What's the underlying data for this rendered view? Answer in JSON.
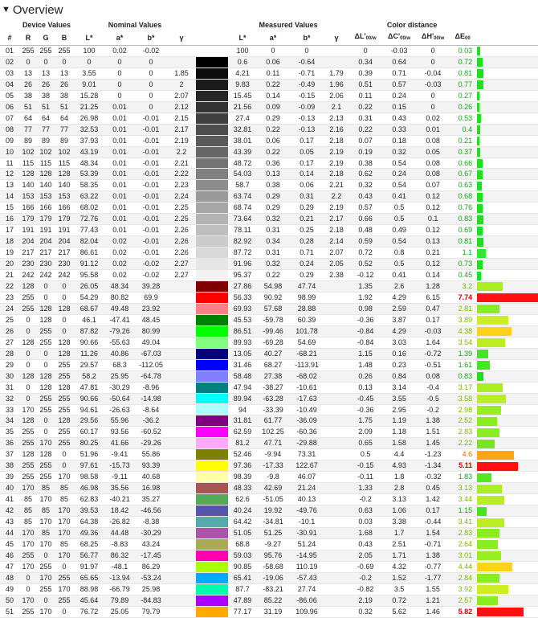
{
  "title": "Overview",
  "groups": {
    "device": "Device Values",
    "nominal": "Nominal Values",
    "measured": "Measured Values",
    "distance": "Color distance"
  },
  "columns": {
    "idx": "#",
    "r": "R",
    "g": "G",
    "b": "B",
    "L": "L*",
    "a": "a*",
    "bb": "b*",
    "gamma": "γ",
    "mL": "L*",
    "ma": "a*",
    "mb": "b*",
    "mgamma": "γ",
    "dL": "ΔL'",
    "dC": "ΔC'",
    "dH": "ΔH'",
    "dE": "ΔE",
    "sub_w": "00/w",
    "sub_00": "00"
  },
  "rows": [
    {
      "i": "01",
      "r": 255,
      "g": 255,
      "b": 255,
      "L": "100",
      "a": "0.02",
      "bb": "-0.02",
      "gm": "",
      "mL": "100",
      "ma": "0",
      "mb": "0",
      "mg": "",
      "dL": "0",
      "dC": "-0.03",
      "dH": "0",
      "dE": "0.03",
      "sw": "#ffffff",
      "bc": "#22dd22",
      "bw": 0.4
    },
    {
      "i": "02",
      "r": 0,
      "g": 0,
      "b": 0,
      "L": "0",
      "a": "0",
      "bb": "0",
      "gm": "",
      "mL": "0.6",
      "ma": "0.06",
      "mb": "-0.64",
      "mg": "",
      "dL": "0.34",
      "dC": "0.64",
      "dH": "0",
      "dE": "0.72",
      "sw": "#000000",
      "bc": "#22dd22",
      "bw": 0.8
    },
    {
      "i": "03",
      "r": 13,
      "g": 13,
      "b": 13,
      "L": "3.55",
      "a": "0",
      "bb": "0",
      "gm": "1.85",
      "mL": "4.21",
      "ma": "0.11",
      "mb": "-0.71",
      "mg": "1.79",
      "dL": "0.39",
      "dC": "0.71",
      "dH": "-0.04",
      "dE": "0.81",
      "sw": "#0d0d0d",
      "bc": "#22dd22",
      "bw": 0.9
    },
    {
      "i": "04",
      "r": 26,
      "g": 26,
      "b": 26,
      "L": "9.01",
      "a": "0",
      "bb": "0",
      "gm": "2",
      "mL": "9.83",
      "ma": "0.22",
      "mb": "-0.49",
      "mg": "1.96",
      "dL": "0.51",
      "dC": "0.57",
      "dH": "-0.03",
      "dE": "0.77",
      "sw": "#1a1a1a",
      "bc": "#22dd22",
      "bw": 0.85
    },
    {
      "i": "05",
      "r": 38,
      "g": 38,
      "b": 38,
      "L": "15.28",
      "a": "0",
      "bb": "0",
      "gm": "2.07",
      "mL": "15.45",
      "ma": "0.14",
      "mb": "-0.15",
      "mg": "2.06",
      "dL": "0.11",
      "dC": "0.24",
      "dH": "0",
      "dE": "0.27",
      "sw": "#262626",
      "bc": "#22dd22",
      "bw": 0.35
    },
    {
      "i": "06",
      "r": 51,
      "g": 51,
      "b": 51,
      "L": "21.25",
      "a": "0.01",
      "bb": "0",
      "gm": "2.12",
      "mL": "21.56",
      "ma": "0.09",
      "mb": "-0.09",
      "mg": "2.1",
      "dL": "0.22",
      "dC": "0.15",
      "dH": "0",
      "dE": "0.26",
      "sw": "#333333",
      "bc": "#22dd22",
      "bw": 0.33
    },
    {
      "i": "07",
      "r": 64,
      "g": 64,
      "b": 64,
      "L": "26.98",
      "a": "0.01",
      "bb": "-0.01",
      "gm": "2.15",
      "mL": "27.4",
      "ma": "0.29",
      "mb": "-0.13",
      "mg": "2.13",
      "dL": "0.31",
      "dC": "0.43",
      "dH": "0.02",
      "dE": "0.53",
      "sw": "#404040",
      "bc": "#22dd22",
      "bw": 0.6
    },
    {
      "i": "08",
      "r": 77,
      "g": 77,
      "b": 77,
      "L": "32.53",
      "a": "0.01",
      "bb": "-0.01",
      "gm": "2.17",
      "mL": "32.81",
      "ma": "0.22",
      "mb": "-0.13",
      "mg": "2.16",
      "dL": "0.22",
      "dC": "0.33",
      "dH": "0.01",
      "dE": "0.4",
      "sw": "#4d4d4d",
      "bc": "#22dd22",
      "bw": 0.45
    },
    {
      "i": "09",
      "r": 89,
      "g": 89,
      "b": 89,
      "L": "37.93",
      "a": "0.01",
      "bb": "-0.01",
      "gm": "2.19",
      "mL": "38.01",
      "ma": "0.06",
      "mb": "0.17",
      "mg": "2.18",
      "dL": "0.07",
      "dC": "0.18",
      "dH": "0.08",
      "dE": "0.21",
      "sw": "#595959",
      "bc": "#22dd22",
      "bw": 0.3
    },
    {
      "i": "10",
      "r": 102,
      "g": 102,
      "b": 102,
      "L": "43.19",
      "a": "0.01",
      "bb": "-0.01",
      "gm": "2.2",
      "mL": "43.39",
      "ma": "0.22",
      "mb": "0.05",
      "mg": "2.19",
      "dL": "0.19",
      "dC": "0.32",
      "dH": "0.05",
      "dE": "0.37",
      "sw": "#666666",
      "bc": "#22dd22",
      "bw": 0.4
    },
    {
      "i": "11",
      "r": 115,
      "g": 115,
      "b": 115,
      "L": "48.34",
      "a": "0.01",
      "bb": "-0.01",
      "gm": "2.21",
      "mL": "48.72",
      "ma": "0.36",
      "mb": "0.17",
      "mg": "2.19",
      "dL": "0.38",
      "dC": "0.54",
      "dH": "0.08",
      "dE": "0.66",
      "sw": "#737373",
      "bc": "#22dd22",
      "bw": 0.72
    },
    {
      "i": "12",
      "r": 128,
      "g": 128,
      "b": 128,
      "L": "53.39",
      "a": "0.01",
      "bb": "-0.01",
      "gm": "2.22",
      "mL": "54.03",
      "ma": "0.13",
      "mb": "0.14",
      "mg": "2.18",
      "dL": "0.62",
      "dC": "0.24",
      "dH": "0.08",
      "dE": "0.67",
      "sw": "#808080",
      "bc": "#22dd22",
      "bw": 0.73
    },
    {
      "i": "13",
      "r": 140,
      "g": 140,
      "b": 140,
      "L": "58.35",
      "a": "0.01",
      "bb": "-0.01",
      "gm": "2.23",
      "mL": "58.7",
      "ma": "0.38",
      "mb": "0.06",
      "mg": "2.21",
      "dL": "0.32",
      "dC": "0.54",
      "dH": "0.07",
      "dE": "0.63",
      "sw": "#8c8c8c",
      "bc": "#22dd22",
      "bw": 0.7
    },
    {
      "i": "14",
      "r": 153,
      "g": 153,
      "b": 153,
      "L": "63.22",
      "a": "0.01",
      "bb": "-0.01",
      "gm": "2.24",
      "mL": "63.74",
      "ma": "0.29",
      "mb": "0.31",
      "mg": "2.2",
      "dL": "0.43",
      "dC": "0.41",
      "dH": "0.12",
      "dE": "0.68",
      "sw": "#999999",
      "bc": "#22dd22",
      "bw": 0.74
    },
    {
      "i": "15",
      "r": 166,
      "g": 166,
      "b": 166,
      "L": "68.02",
      "a": "0.01",
      "bb": "-0.01",
      "gm": "2.25",
      "mL": "68.74",
      "ma": "0.29",
      "mb": "0.29",
      "mg": "2.19",
      "dL": "0.57",
      "dC": "0.5",
      "dH": "0.12",
      "dE": "0.76",
      "sw": "#a6a6a6",
      "bc": "#22dd22",
      "bw": 0.82
    },
    {
      "i": "16",
      "r": 179,
      "g": 179,
      "b": 179,
      "L": "72.76",
      "a": "0.01",
      "bb": "-0.01",
      "gm": "2.25",
      "mL": "73.64",
      "ma": "0.32",
      "mb": "0.21",
      "mg": "2.17",
      "dL": "0.66",
      "dC": "0.5",
      "dH": "0.1",
      "dE": "0.83",
      "sw": "#b3b3b3",
      "bc": "#22dd22",
      "bw": 0.9
    },
    {
      "i": "17",
      "r": 191,
      "g": 191,
      "b": 191,
      "L": "77.43",
      "a": "0.01",
      "bb": "-0.01",
      "gm": "2.26",
      "mL": "78.11",
      "ma": "0.31",
      "mb": "0.25",
      "mg": "2.18",
      "dL": "0.48",
      "dC": "0.49",
      "dH": "0.12",
      "dE": "0.69",
      "sw": "#bfbfbf",
      "bc": "#22dd22",
      "bw": 0.75
    },
    {
      "i": "18",
      "r": 204,
      "g": 204,
      "b": 204,
      "L": "82.04",
      "a": "0.02",
      "bb": "-0.01",
      "gm": "2.26",
      "mL": "82.92",
      "ma": "0.34",
      "mb": "0.28",
      "mg": "2.14",
      "dL": "0.59",
      "dC": "0.54",
      "dH": "0.13",
      "dE": "0.81",
      "sw": "#cccccc",
      "bc": "#22dd22",
      "bw": 0.88
    },
    {
      "i": "19",
      "r": 217,
      "g": 217,
      "b": 217,
      "L": "86.61",
      "a": "0.02",
      "bb": "-0.01",
      "gm": "2.26",
      "mL": "87.72",
      "ma": "0.31",
      "mb": "0.71",
      "mg": "2.07",
      "dL": "0.72",
      "dC": "0.8",
      "dH": "0.21",
      "dE": "1.1",
      "sw": "#d9d9d9",
      "bc": "#33e633",
      "bw": 1.2
    },
    {
      "i": "20",
      "r": 230,
      "g": 230,
      "b": 230,
      "L": "91.12",
      "a": "0.02",
      "bb": "-0.02",
      "gm": "2.27",
      "mL": "91.96",
      "ma": "0.32",
      "mb": "0.24",
      "mg": "2.05",
      "dL": "0.52",
      "dC": "0.5",
      "dH": "0.12",
      "dE": "0.73",
      "sw": "#e6e6e6",
      "bc": "#22dd22",
      "bw": 0.8
    },
    {
      "i": "21",
      "r": 242,
      "g": 242,
      "b": 242,
      "L": "95.58",
      "a": "0.02",
      "bb": "-0.02",
      "gm": "2.27",
      "mL": "95.37",
      "ma": "0.22",
      "mb": "0.29",
      "mg": "2.38",
      "dL": "-0.12",
      "dC": "0.41",
      "dH": "0.14",
      "dE": "0.45",
      "sw": "#f2f2f2",
      "bc": "#22dd22",
      "bw": 0.5
    },
    {
      "i": "22",
      "r": 128,
      "g": 0,
      "b": 0,
      "L": "26.05",
      "a": "48.34",
      "bb": "39.28",
      "gm": "",
      "mL": "27.86",
      "ma": "54.98",
      "mb": "47.74",
      "mg": "",
      "dL": "1.35",
      "dC": "2.6",
      "dH": "1.28",
      "dE": "3.2",
      "sw": "#800000",
      "bc": "#aaee22",
      "bw": 3.5
    },
    {
      "i": "23",
      "r": 255,
      "g": 0,
      "b": 0,
      "L": "54.29",
      "a": "80.82",
      "bb": "69.9",
      "gm": "",
      "mL": "56.33",
      "ma": "90.92",
      "mb": "98.99",
      "mg": "",
      "dL": "1.92",
      "dC": "4.29",
      "dH": "6.15",
      "dE": "7.74",
      "sw": "#ff0000",
      "bc": "#ff1111",
      "bw": 8.6,
      "red": true
    },
    {
      "i": "24",
      "r": 255,
      "g": 128,
      "b": 128,
      "L": "68.67",
      "a": "49.48",
      "bb": "23.92",
      "gm": "",
      "mL": "69.93",
      "ma": "57.68",
      "mb": "28.88",
      "mg": "",
      "dL": "0.98",
      "dC": "2.59",
      "dH": "0.47",
      "dE": "2.81",
      "sw": "#ff8080",
      "bc": "#88ee22",
      "bw": 3.1
    },
    {
      "i": "25",
      "r": 0,
      "g": 128,
      "b": 0,
      "L": "46.1",
      "a": "-47.41",
      "bb": "48.45",
      "gm": "",
      "mL": "45.53",
      "ma": "-59.78",
      "mb": "60.39",
      "mg": "",
      "dL": "-0.36",
      "dC": "3.87",
      "dH": "0.17",
      "dE": "3.89",
      "sw": "#008000",
      "bc": "#ccee22",
      "bw": 4.3
    },
    {
      "i": "26",
      "r": 0,
      "g": 255,
      "b": 0,
      "L": "87.82",
      "a": "-79.26",
      "bb": "80.99",
      "gm": "",
      "mL": "86.51",
      "ma": "-99.46",
      "mb": "101.78",
      "mg": "",
      "dL": "-0.84",
      "dC": "4.29",
      "dH": "-0.03",
      "dE": "4.38",
      "sw": "#00ff00",
      "bc": "#ffd21a",
      "bw": 4.8
    },
    {
      "i": "27",
      "r": 128,
      "g": 255,
      "b": 128,
      "L": "90.66",
      "a": "-55.63",
      "bb": "49.04",
      "gm": "",
      "mL": "89.93",
      "ma": "-69.28",
      "mb": "54.69",
      "mg": "",
      "dL": "-0.84",
      "dC": "3.03",
      "dH": "1.64",
      "dE": "3.54",
      "sw": "#80ff80",
      "bc": "#bbee22",
      "bw": 3.9
    },
    {
      "i": "28",
      "r": 0,
      "g": 0,
      "b": 128,
      "L": "11.26",
      "a": "40.86",
      "bb": "-67.03",
      "gm": "",
      "mL": "13.05",
      "ma": "40.27",
      "mb": "-68.21",
      "mg": "",
      "dL": "1.15",
      "dC": "0.16",
      "dH": "-0.72",
      "dE": "1.39",
      "sw": "#000080",
      "bc": "#44e622",
      "bw": 1.5
    },
    {
      "i": "29",
      "r": 0,
      "g": 0,
      "b": 255,
      "L": "29.57",
      "a": "68.3",
      "bb": "-112.05",
      "gm": "",
      "mL": "31.46",
      "ma": "68.27",
      "mb": "-113.91",
      "mg": "",
      "dL": "1.48",
      "dC": "0.23",
      "dH": "-0.51",
      "dE": "1.61",
      "sw": "#0000ff",
      "bc": "#44e622",
      "bw": 1.8
    },
    {
      "i": "30",
      "r": 128,
      "g": 128,
      "b": 255,
      "L": "58.2",
      "a": "25.95",
      "bb": "-64.78",
      "gm": "",
      "mL": "58.48",
      "ma": "27.38",
      "mb": "-68.02",
      "mg": "",
      "dL": "0.26",
      "dC": "0.84",
      "dH": "0.08",
      "dE": "0.83",
      "sw": "#8080ff",
      "bc": "#22dd22",
      "bw": 0.9
    },
    {
      "i": "31",
      "r": 0,
      "g": 128,
      "b": 128,
      "L": "47.81",
      "a": "-30.29",
      "bb": "-8.96",
      "gm": "",
      "mL": "47.94",
      "ma": "-38.27",
      "mb": "-10.61",
      "mg": "",
      "dL": "0.13",
      "dC": "3.14",
      "dH": "-0.4",
      "dE": "3.17",
      "sw": "#008080",
      "bc": "#aaee22",
      "bw": 3.5
    },
    {
      "i": "32",
      "r": 0,
      "g": 255,
      "b": 255,
      "L": "90.66",
      "a": "-50.64",
      "bb": "-14.98",
      "gm": "",
      "mL": "89.94",
      "ma": "-63.28",
      "mb": "-17.63",
      "mg": "",
      "dL": "-0.45",
      "dC": "3.55",
      "dH": "-0.5",
      "dE": "3.58",
      "sw": "#00ffff",
      "bc": "#bbee22",
      "bw": 3.95
    },
    {
      "i": "33",
      "r": 170,
      "g": 255,
      "b": 255,
      "L": "94.61",
      "a": "-26.63",
      "bb": "-8.64",
      "gm": "",
      "mL": "94",
      "ma": "-33.39",
      "mb": "-10.49",
      "mg": "",
      "dL": "-0.36",
      "dC": "2.95",
      "dH": "-0.2",
      "dE": "2.98",
      "sw": "#aaffff",
      "bc": "#99ee22",
      "bw": 3.3
    },
    {
      "i": "34",
      "r": 128,
      "g": 0,
      "b": 128,
      "L": "29.56",
      "a": "55.96",
      "bb": "-36.2",
      "gm": "",
      "mL": "31.81",
      "ma": "61.77",
      "mb": "-36.09",
      "mg": "",
      "dL": "1.75",
      "dC": "1.19",
      "dH": "1.38",
      "dE": "2.52",
      "sw": "#800080",
      "bc": "#88ee22",
      "bw": 2.8
    },
    {
      "i": "35",
      "r": 255,
      "g": 0,
      "b": 255,
      "L": "60.17",
      "a": "93.56",
      "bb": "-60.52",
      "gm": "",
      "mL": "62.59",
      "ma": "102.25",
      "mb": "-60.36",
      "mg": "",
      "dL": "2.09",
      "dC": "1.18",
      "dH": "1.51",
      "dE": "2.83",
      "sw": "#ff00ff",
      "bc": "#88ee22",
      "bw": 3.1
    },
    {
      "i": "36",
      "r": 255,
      "g": 170,
      "b": 255,
      "L": "80.25",
      "a": "41.66",
      "bb": "-29.26",
      "gm": "",
      "mL": "81.2",
      "ma": "47.71",
      "mb": "-29.88",
      "mg": "",
      "dL": "0.65",
      "dC": "1.58",
      "dH": "1.45",
      "dE": "2.22",
      "sw": "#ffaaff",
      "bc": "#77e622",
      "bw": 2.45
    },
    {
      "i": "37",
      "r": 128,
      "g": 128,
      "b": 0,
      "L": "51.96",
      "a": "-9.41",
      "bb": "55.86",
      "gm": "",
      "mL": "52.46",
      "ma": "-9.94",
      "mb": "73.31",
      "mg": "",
      "dL": "0.5",
      "dC": "4.4",
      "dH": "-1.23",
      "dE": "4.6",
      "sw": "#808000",
      "bc": "#ffa51a",
      "bw": 5.1
    },
    {
      "i": "38",
      "r": 255,
      "g": 255,
      "b": 0,
      "L": "97.61",
      "a": "-15.73",
      "bb": "93.39",
      "gm": "",
      "mL": "97.36",
      "ma": "-17.33",
      "mb": "122.67",
      "mg": "",
      "dL": "-0.15",
      "dC": "4.93",
      "dH": "-1.34",
      "dE": "5.11",
      "sw": "#ffff00",
      "bc": "#ff1111",
      "bw": 5.7,
      "red": true
    },
    {
      "i": "39",
      "r": 255,
      "g": 255,
      "b": 170,
      "L": "98.58",
      "a": "-9.11",
      "bb": "40.68",
      "gm": "",
      "mL": "98.39",
      "ma": "-9.8",
      "mb": "46.07",
      "mg": "",
      "dL": "-0.11",
      "dC": "1.8",
      "dH": "-0.32",
      "dE": "1.83",
      "sw": "#ffffaa",
      "bc": "#55e622",
      "bw": 2.0
    },
    {
      "i": "40",
      "r": 170,
      "g": 85,
      "b": 85,
      "L": "46.98",
      "a": "35.56",
      "bb": "16.98",
      "gm": "",
      "mL": "48.33",
      "ma": "42.69",
      "mb": "21.24",
      "mg": "",
      "dL": "1.33",
      "dC": "2.8",
      "dH": "0.45",
      "dE": "3.13",
      "sw": "#aa5555",
      "bc": "#aaee22",
      "bw": 3.45
    },
    {
      "i": "41",
      "r": 85,
      "g": 170,
      "b": 85,
      "L": "62.83",
      "a": "-40.21",
      "bb": "35.27",
      "gm": "",
      "mL": "62.6",
      "ma": "-51.05",
      "mb": "40.13",
      "mg": "",
      "dL": "-0.2",
      "dC": "3.13",
      "dH": "1.42",
      "dE": "3.44",
      "sw": "#55aa55",
      "bc": "#bbee22",
      "bw": 3.8
    },
    {
      "i": "42",
      "r": 85,
      "g": 85,
      "b": 170,
      "L": "39.53",
      "a": "18.42",
      "bb": "-46.56",
      "gm": "",
      "mL": "40.24",
      "ma": "19.92",
      "mb": "-49.76",
      "mg": "",
      "dL": "0.63",
      "dC": "1.06",
      "dH": "0.17",
      "dE": "1.15",
      "sw": "#5555aa",
      "bc": "#44e622",
      "bw": 1.3
    },
    {
      "i": "43",
      "r": 85,
      "g": 170,
      "b": 170,
      "L": "64.38",
      "a": "-26.82",
      "bb": "-8.38",
      "gm": "",
      "mL": "64.42",
      "ma": "-34.81",
      "mb": "-10.1",
      "mg": "",
      "dL": "0.03",
      "dC": "3.38",
      "dH": "-0.44",
      "dE": "3.41",
      "sw": "#55aaaa",
      "bc": "#bbee22",
      "bw": 3.75
    },
    {
      "i": "44",
      "r": 170,
      "g": 85,
      "b": 170,
      "L": "49.36",
      "a": "44.48",
      "bb": "-30.29",
      "gm": "",
      "mL": "51.05",
      "ma": "51.25",
      "mb": "-30.91",
      "mg": "",
      "dL": "1.68",
      "dC": "1.7",
      "dH": "1.54",
      "dE": "2.83",
      "sw": "#aa55aa",
      "bc": "#88ee22",
      "bw": 3.1
    },
    {
      "i": "45",
      "r": 170,
      "g": 170,
      "b": 85,
      "L": "68.25",
      "a": "-8.83",
      "bb": "43.24",
      "gm": "",
      "mL": "68.8",
      "ma": "-9.27",
      "mb": "51.24",
      "mg": "",
      "dL": "0.43",
      "dC": "2.51",
      "dH": "-0.71",
      "dE": "2.64",
      "sw": "#aaaa55",
      "bc": "#88ee22",
      "bw": 2.9
    },
    {
      "i": "46",
      "r": 255,
      "g": 0,
      "b": 170,
      "L": "56.77",
      "a": "86.32",
      "bb": "-17.45",
      "gm": "",
      "mL": "59.03",
      "ma": "95.76",
      "mb": "-14.95",
      "mg": "",
      "dL": "2.05",
      "dC": "1.71",
      "dH": "1.38",
      "dE": "3.01",
      "sw": "#ff00aa",
      "bc": "#99ee22",
      "bw": 3.3
    },
    {
      "i": "47",
      "r": 170,
      "g": 255,
      "b": 0,
      "L": "91.97",
      "a": "-48.1",
      "bb": "86.29",
      "gm": "",
      "mL": "90.85",
      "ma": "-58.68",
      "mb": "110.19",
      "mg": "",
      "dL": "-0.69",
      "dC": "4.32",
      "dH": "-0.77",
      "dE": "4.44",
      "sw": "#aaff00",
      "bc": "#ffd21a",
      "bw": 4.9
    },
    {
      "i": "48",
      "r": 0,
      "g": 170,
      "b": 255,
      "L": "65.65",
      "a": "-13.94",
      "bb": "-53.24",
      "gm": "",
      "mL": "65.41",
      "ma": "-19.06",
      "mb": "-57.43",
      "mg": "",
      "dL": "-0.2",
      "dC": "1.52",
      "dH": "-1.77",
      "dE": "2.84",
      "sw": "#00aaff",
      "bc": "#88ee22",
      "bw": 3.1
    },
    {
      "i": "49",
      "r": 0,
      "g": 255,
      "b": 170,
      "L": "88.98",
      "a": "-66.79",
      "bb": "25.98",
      "gm": "",
      "mL": "87.7",
      "ma": "-83.21",
      "mb": "27.74",
      "mg": "",
      "dL": "-0.82",
      "dC": "3.5",
      "dH": "1.55",
      "dE": "3.92",
      "sw": "#00ffaa",
      "bc": "#ccee22",
      "bw": 4.3
    },
    {
      "i": "50",
      "r": 170,
      "g": 0,
      "b": 255,
      "L": "45.64",
      "a": "79.89",
      "bb": "-84.83",
      "gm": "",
      "mL": "47.89",
      "ma": "85.22",
      "mb": "-86.06",
      "mg": "",
      "dL": "2.19",
      "dC": "0.72",
      "dH": "1.21",
      "dE": "2.57",
      "sw": "#aa00ff",
      "bc": "#88ee22",
      "bw": 2.85
    },
    {
      "i": "51",
      "r": 255,
      "g": 170,
      "b": 0,
      "L": "76.72",
      "a": "25.05",
      "bb": "79.79",
      "gm": "",
      "mL": "77.17",
      "ma": "31.19",
      "mb": "109.96",
      "mg": "",
      "dL": "0.32",
      "dC": "5.62",
      "dH": "1.46",
      "dE": "5.82",
      "sw": "#ffaa00",
      "bc": "#ff1111",
      "bw": 6.4,
      "red": true
    }
  ]
}
